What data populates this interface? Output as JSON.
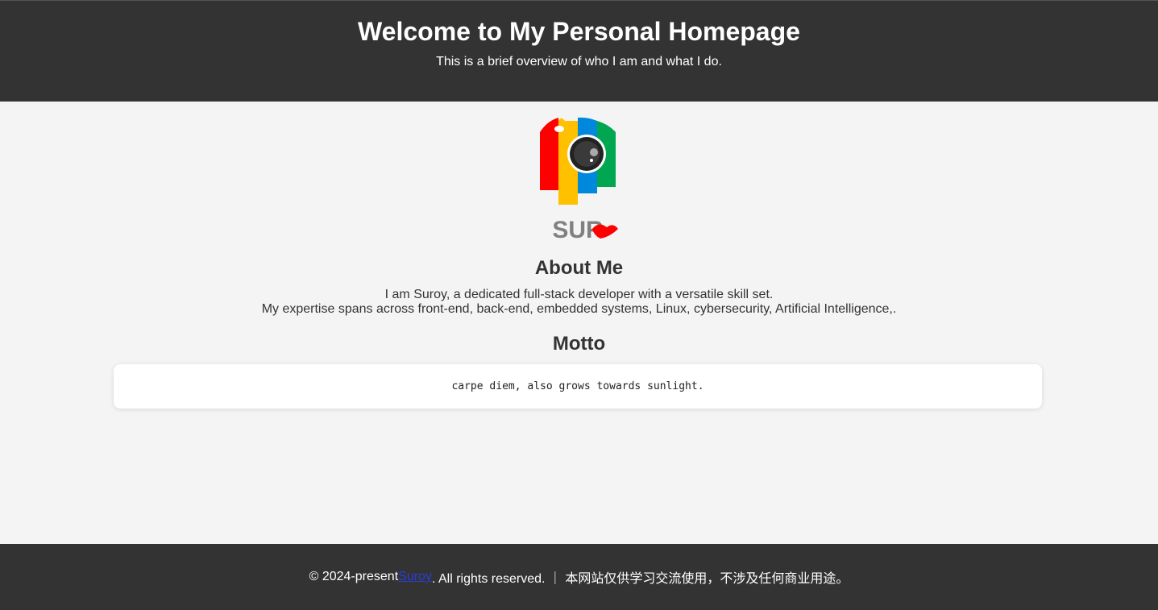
{
  "header": {
    "title": "Welcome to My Personal Homepage",
    "subtitle": "This is a brief overview of who I am and what I do."
  },
  "logo": {
    "icon": "camera-logo-icon",
    "wordmark": "SUROY",
    "colors": [
      "#ff0000",
      "#ffc000",
      "#0088dd",
      "#00a650"
    ]
  },
  "about": {
    "title": "About Me",
    "line1": "I am Suroy, a dedicated full-stack developer with a versatile skill set.",
    "line2": "My expertise spans across front-end, back-end, embedded systems, Linux, cybersecurity, Artificial Intelligence,."
  },
  "motto": {
    "title": "Motto",
    "text": "carpe diem, also grows towards sunlight."
  },
  "footer": {
    "prefix": "© 2024-present ",
    "link_text": "Suroy",
    "suffix": ". All rights reserved. ｜ 本网站仅供学习交流使用，不涉及任何商业用途。"
  },
  "colors": {
    "header_bg": "#333333",
    "page_bg": "#f4f4f4",
    "link": "#2a3fd6"
  }
}
